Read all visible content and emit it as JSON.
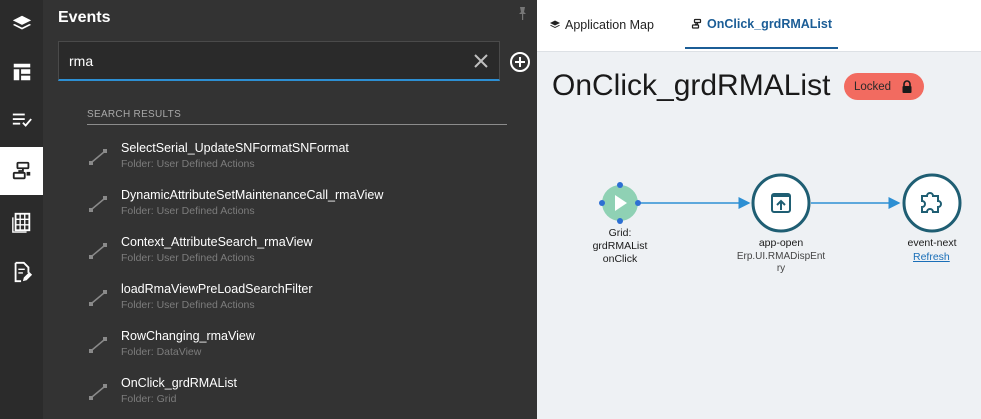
{
  "sidebar": {
    "items": [
      {
        "icon": "layers-icon"
      },
      {
        "icon": "layout-icon"
      },
      {
        "icon": "checklist-icon"
      },
      {
        "icon": "events-icon",
        "active": true
      },
      {
        "icon": "table-icon"
      },
      {
        "icon": "edit-document-icon"
      }
    ]
  },
  "panel": {
    "title": "Events",
    "search": {
      "value": "rma",
      "placeholder": ""
    },
    "results_label": "SEARCH RESULTS",
    "results": [
      {
        "name": "SelectSerial_UpdateSNFormatSNFormat",
        "folder": "Folder: User Defined Actions"
      },
      {
        "name": "DynamicAttributeSetMaintenanceCall_rmaView",
        "folder": "Folder: User Defined Actions"
      },
      {
        "name": "Context_AttributeSearch_rmaView",
        "folder": "Folder: User Defined Actions"
      },
      {
        "name": "loadRmaViewPreLoadSearchFilter",
        "folder": "Folder: User Defined Actions"
      },
      {
        "name": "RowChanging_rmaView",
        "folder": "Folder: DataView"
      },
      {
        "name": "OnClick_grdRMAList",
        "folder": "Folder: Grid"
      }
    ]
  },
  "tabs": [
    {
      "label": "Application Map",
      "icon": "layers-icon"
    },
    {
      "label": "OnClick_grdRMAList",
      "icon": "events-icon",
      "active": true
    }
  ],
  "main": {
    "title": "OnClick_grdRMAList",
    "badge": "Locked"
  },
  "flow": {
    "trigger": {
      "line1": "Grid:",
      "line2": "grdRMAList",
      "line3": "onClick"
    },
    "step1": {
      "label": "app-open",
      "sub1": "Erp.UI.RMADispEnt",
      "sub2": "ry"
    },
    "step2": {
      "label": "event-next",
      "link": "Refresh"
    }
  },
  "colors": {
    "accent": "#2d8fd3",
    "node": "#1f5e73",
    "trigger": "#8fd1b4",
    "locked": "#f26b60"
  }
}
